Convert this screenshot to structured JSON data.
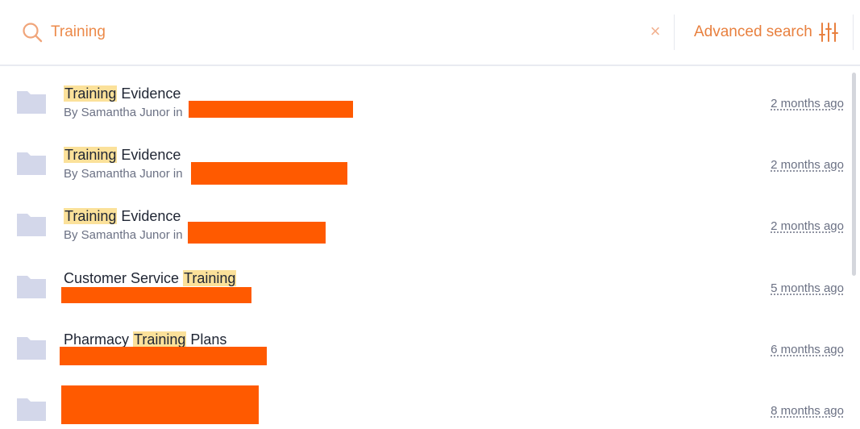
{
  "search": {
    "query": "Training"
  },
  "advanced_search_label": "Advanced search",
  "colors": {
    "accent": "#e8803f",
    "highlight": "#fbe19a",
    "redaction": "#ff5a00"
  },
  "results": [
    {
      "title_parts": [
        "Training",
        " Evidence"
      ],
      "author": "By Samantha Junor",
      "in_label": "in",
      "time": "2 months ago"
    },
    {
      "title_parts": [
        "Training",
        " Evidence"
      ],
      "author": "By Samantha Junor",
      "in_label": "in",
      "time": "2 months ago"
    },
    {
      "title_parts": [
        "Training",
        " Evidence"
      ],
      "author": "By Samantha Junor",
      "in_label": "in",
      "time": "2 months ago"
    },
    {
      "title_parts": [
        "Customer Service ",
        "Training"
      ],
      "time": "5 months ago"
    },
    {
      "title_parts": [
        "Pharmacy ",
        "Training",
        " Plans"
      ],
      "time": "6 months ago"
    },
    {
      "time": "8 months ago"
    }
  ]
}
